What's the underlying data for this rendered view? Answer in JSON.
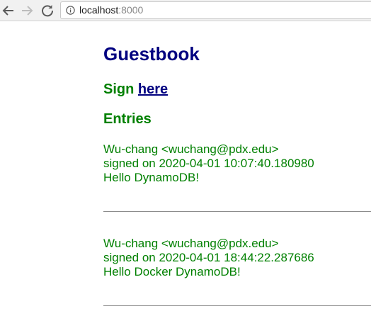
{
  "browser": {
    "url_host": "localhost",
    "url_port": ":8000",
    "icons": {
      "back": "back-arrow-icon",
      "forward": "forward-arrow-icon",
      "reload": "reload-icon",
      "info": "info-icon"
    }
  },
  "page": {
    "title": "Guestbook",
    "sign_prefix": "Sign",
    "sign_link": "here",
    "entries_heading": "Entries",
    "entries": [
      {
        "author": "Wu-chang <wuchang@pdx.edu>",
        "signed": "signed on 2020-04-01 10:07:40.180980",
        "message": "Hello DynamoDB!"
      },
      {
        "author": "Wu-chang <wuchang@pdx.edu>",
        "signed": "signed on 2020-04-01 18:44:22.287686",
        "message": "Hello Docker DynamoDB!"
      }
    ]
  },
  "colors": {
    "title": "#000080",
    "green_text": "#008000",
    "link": "#000080"
  }
}
